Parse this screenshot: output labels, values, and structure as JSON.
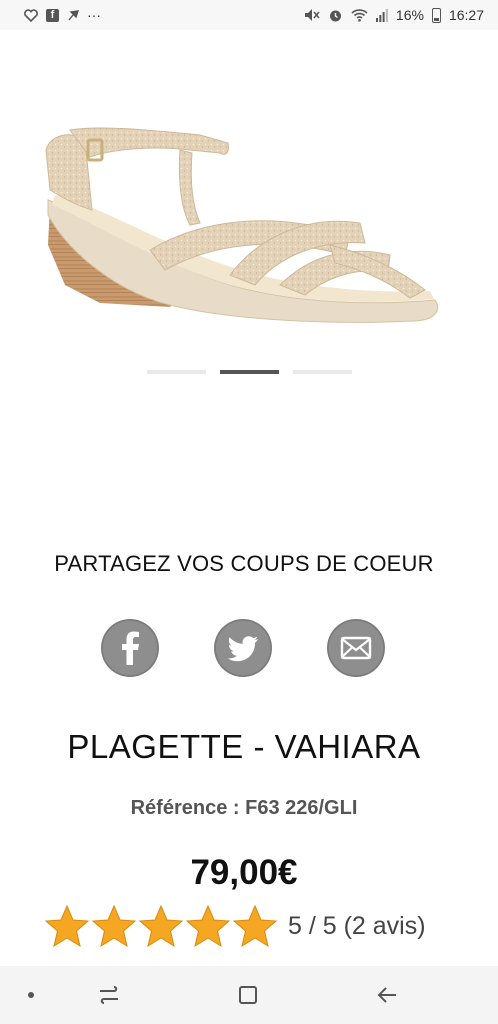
{
  "status_bar": {
    "notification_icons": [
      "heart-icon",
      "facebook-icon",
      "pin-icon",
      "more-icon"
    ],
    "more_glyph": "···",
    "battery": "16%",
    "time": "16:27"
  },
  "carousel": {
    "count": 3,
    "active_index": 1
  },
  "share": {
    "title": "PARTAGEZ VOS COUPS DE COEUR",
    "buttons": [
      "facebook-icon",
      "twitter-icon",
      "mail-icon"
    ]
  },
  "product": {
    "name": "PLAGETTE - VAHIARA",
    "reference": "Référence : F63 226/GLI",
    "price": "79,00€",
    "rating_stars": 5,
    "rating_text": "5 / 5 (2 avis)"
  },
  "colors": {
    "share_icon_bg": "#8e8e8e",
    "star": "#f5a623",
    "active_dot": "#555555"
  },
  "nav_bar": {
    "buttons": [
      "dot-icon",
      "recent-apps-icon",
      "home-icon",
      "back-icon"
    ]
  }
}
